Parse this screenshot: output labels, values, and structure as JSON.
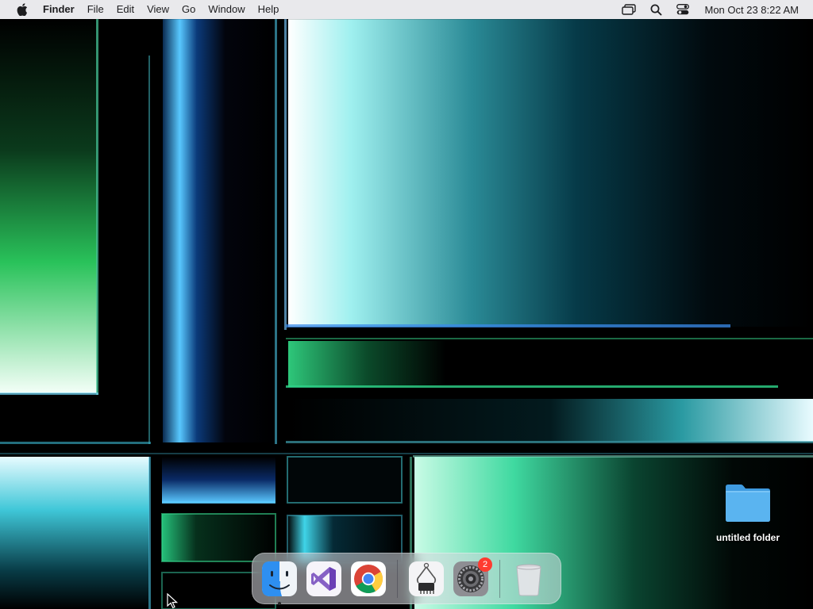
{
  "menubar": {
    "apple_icon": "apple-icon",
    "app_name": "Finder",
    "menus": [
      "File",
      "Edit",
      "View",
      "Go",
      "Window",
      "Help"
    ],
    "status_icons": [
      "screen-mirroring-icon",
      "search-icon",
      "control-center-icon"
    ],
    "clock": "Mon Oct 23  8:22 AM"
  },
  "desktop": {
    "items": [
      {
        "label": "untitled folder",
        "icon": "folder-icon"
      }
    ]
  },
  "dock": {
    "apps": [
      {
        "name": "Finder",
        "icon": "finder-icon",
        "running": true
      },
      {
        "name": "Visual Studio",
        "icon": "visual-studio-icon",
        "running": false
      },
      {
        "name": "Google Chrome",
        "icon": "chrome-icon",
        "running": false
      },
      {
        "name": "System Information",
        "icon": "system-information-icon",
        "running": false
      },
      {
        "name": "System Settings",
        "icon": "system-settings-icon",
        "running": false,
        "badge": "2"
      },
      {
        "name": "Trash",
        "icon": "trash-icon",
        "running": false
      }
    ]
  },
  "colors": {
    "menubar_bg": "#e9e9ec",
    "folder_blue": "#5ab4f0",
    "badge_red": "#ff3b30",
    "wallpaper_cyan": "#5fe6f0",
    "wallpaper_green": "#3fd99a"
  }
}
